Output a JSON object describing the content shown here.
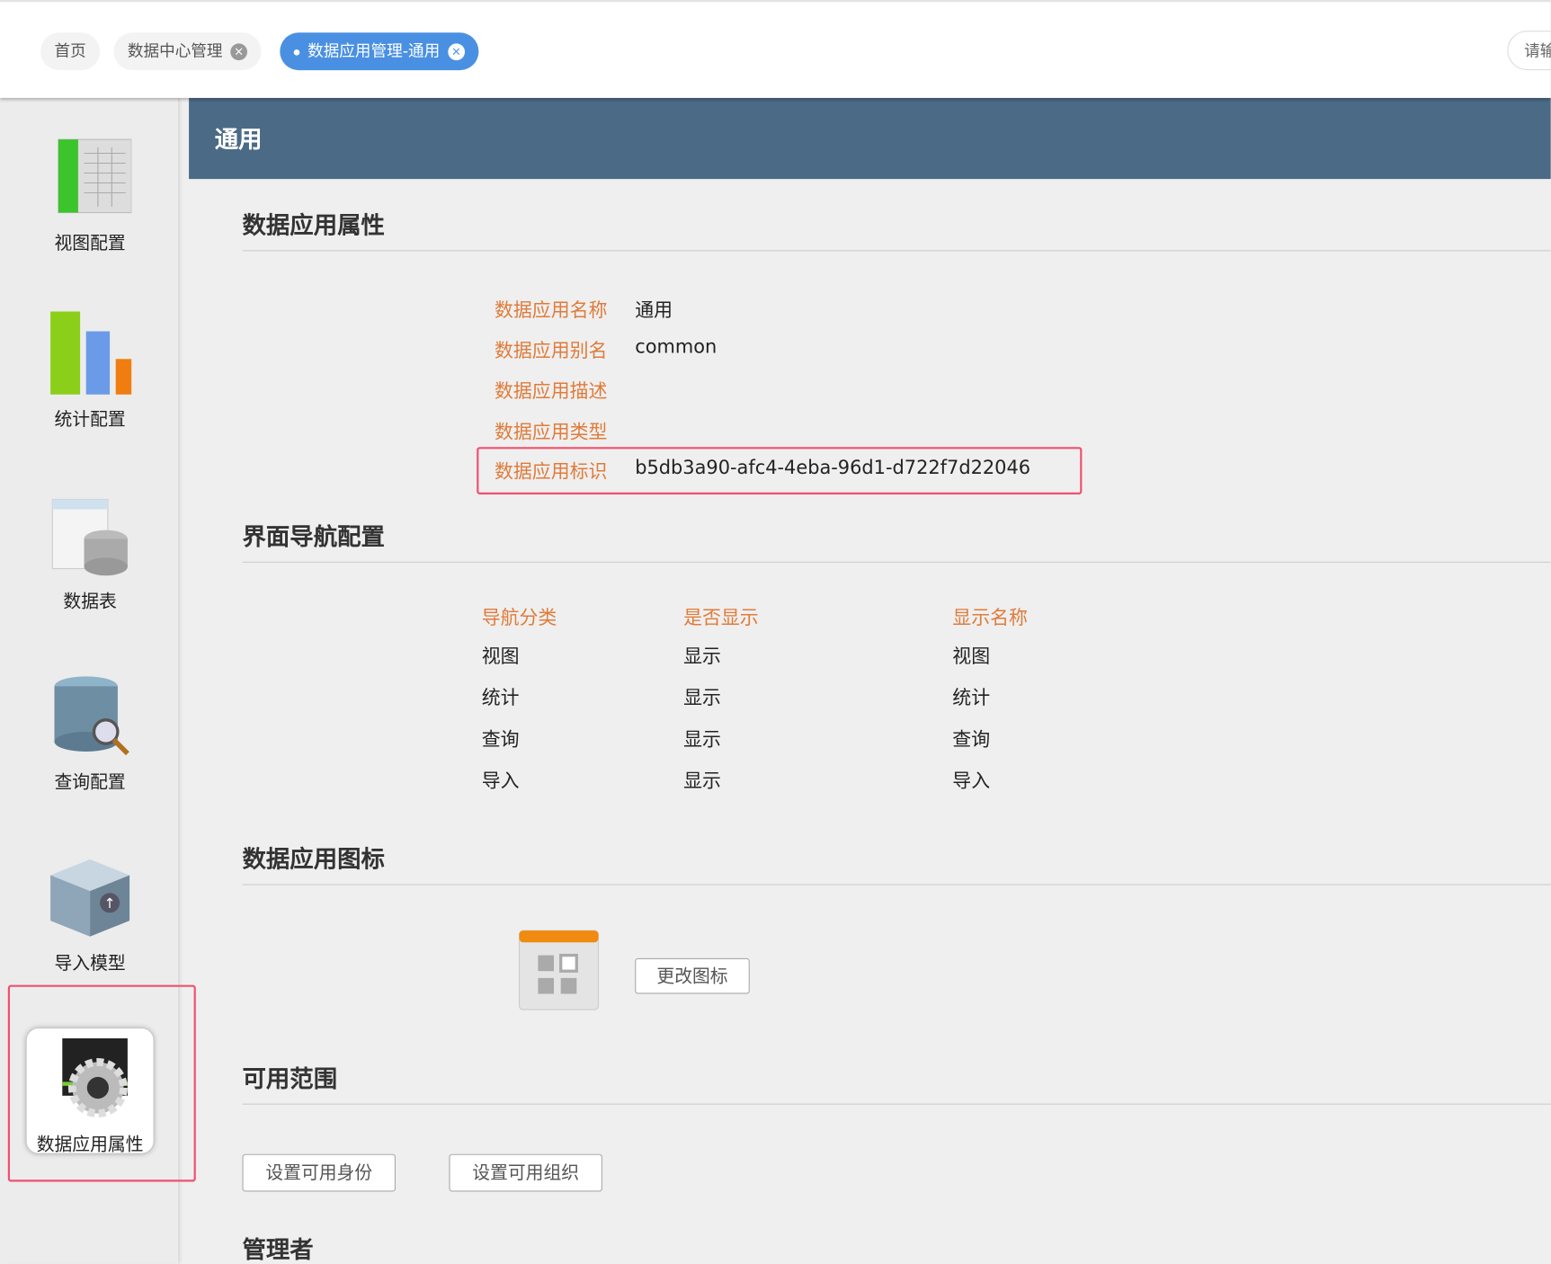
{
  "tabs": [
    {
      "label": "首页"
    },
    {
      "label": "数据中心管理",
      "close": "×"
    },
    {
      "label": "数据应用管理-通用",
      "close": "×"
    }
  ],
  "search_placeholder": "请输",
  "sidebar": {
    "items": [
      {
        "label": "视图配置",
        "icon": "view-config-icon"
      },
      {
        "label": "统计配置",
        "icon": "bar-chart-icon"
      },
      {
        "label": "数据表",
        "icon": "data-table-icon"
      },
      {
        "label": "查询配置",
        "icon": "database-search-icon"
      },
      {
        "label": "导入模型",
        "icon": "import-box-icon"
      },
      {
        "label": "数据应用属性",
        "icon": "app-settings-gear-icon"
      }
    ]
  },
  "page_title": "通用",
  "attributes": {
    "heading": "数据应用属性",
    "rows": [
      {
        "label": "数据应用名称",
        "value": "通用"
      },
      {
        "label": "数据应用别名",
        "value": "common"
      },
      {
        "label": "数据应用描述",
        "value": ""
      },
      {
        "label": "数据应用类型",
        "value": ""
      },
      {
        "label": "数据应用标识",
        "value": "b5db3a90-afc4-4eba-96d1-d722f7d22046"
      }
    ]
  },
  "nav": {
    "heading": "界面导航配置",
    "headers": [
      "导航分类",
      "是否显示",
      "显示名称"
    ],
    "rows": [
      [
        "视图",
        "显示",
        "视图"
      ],
      [
        "统计",
        "显示",
        "统计"
      ],
      [
        "查询",
        "显示",
        "查询"
      ],
      [
        "导入",
        "显示",
        "导入"
      ]
    ]
  },
  "icon_section": {
    "heading": "数据应用图标",
    "change_button": "更改图标"
  },
  "scope": {
    "heading": "可用范围",
    "buttons": [
      "设置可用身份",
      "设置可用组织"
    ]
  },
  "admin": {
    "heading": "管理者"
  },
  "colors": {
    "accent": "#4a90e2",
    "label": "#e07b39",
    "band": "#4b6a86",
    "highlight": "#f0506e"
  }
}
